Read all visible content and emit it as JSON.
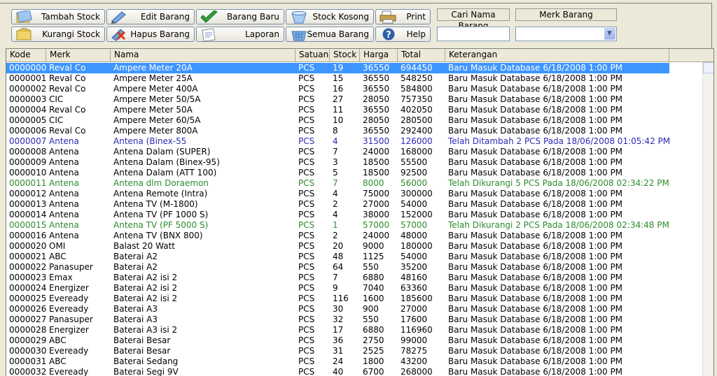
{
  "toolbar": {
    "buttons": [
      {
        "key": "tambah",
        "label": "Tambah Stock",
        "icon": "add-stock-icon"
      },
      {
        "key": "kurangi",
        "label": "Kurangi Stock",
        "icon": "reduce-stock-icon"
      },
      {
        "key": "edit",
        "label": "Edit Barang",
        "icon": "edit-item-icon"
      },
      {
        "key": "hapus",
        "label": "Hapus Barang",
        "icon": "delete-item-icon"
      },
      {
        "key": "baru",
        "label": "Barang Baru",
        "icon": "checkmark-icon"
      },
      {
        "key": "laporan",
        "label": "Laporan",
        "icon": "report-icon"
      },
      {
        "key": "kosong",
        "label": "Stock Kosong",
        "icon": "empty-stock-icon"
      },
      {
        "key": "semua",
        "label": "Semua Barang",
        "icon": "all-items-icon"
      },
      {
        "key": "print",
        "label": "Print",
        "icon": "printer-icon"
      },
      {
        "key": "help",
        "label": "Help",
        "icon": "help-icon"
      }
    ]
  },
  "search": {
    "name_label": "Cari Nama Barang",
    "name_value": "",
    "brand_label": "Merk Barang",
    "brand_value": ""
  },
  "table": {
    "columns": [
      "Kode",
      "Merk",
      "Nama",
      "Satuan",
      "Stock",
      "Harga",
      "Total",
      "Keterangan"
    ],
    "selected_index": 0,
    "rows": [
      [
        "0000000",
        "Reval Co",
        "Ampere Meter 20A",
        "PCS",
        "19",
        "36550",
        "694450",
        "Baru Masuk Database 6/18/2008 1:00 PM",
        "normal"
      ],
      [
        "0000001",
        "Reval Co",
        "Ampere Meter 25A",
        "PCS",
        "15",
        "36550",
        "548250",
        "Baru Masuk Database 6/18/2008 1:00 PM",
        "normal"
      ],
      [
        "0000002",
        "Reval Co",
        "Ampere Meter 400A",
        "PCS",
        "16",
        "36550",
        "584800",
        "Baru Masuk Database 6/18/2008 1:00 PM",
        "normal"
      ],
      [
        "0000003",
        "CIC",
        "Ampere Meter 50/5A",
        "PCS",
        "27",
        "28050",
        "757350",
        "Baru Masuk Database 6/18/2008 1:00 PM",
        "normal"
      ],
      [
        "0000004",
        "Reval Co",
        "Ampere Meter 50A",
        "PCS",
        "11",
        "36550",
        "402050",
        "Baru Masuk Database 6/18/2008 1:00 PM",
        "normal"
      ],
      [
        "0000005",
        "CIC",
        "Ampere Meter 60/5A",
        "PCS",
        "10",
        "28050",
        "280500",
        "Baru Masuk Database 6/18/2008 1:00 PM",
        "normal"
      ],
      [
        "0000006",
        "Reval Co",
        "Ampere Meter 800A",
        "PCS",
        "8",
        "36550",
        "292400",
        "Baru Masuk Database 6/18/2008 1:00 PM",
        "normal"
      ],
      [
        "0000007",
        "Antena",
        "Antena  (Binex-55",
        "PCS",
        "4",
        "31500",
        "126000",
        "Telah Ditambah 2 PCS Pada 18/06/2008 01:05:42 PM",
        "added"
      ],
      [
        "0000008",
        "Antena",
        "Antena Dalam (SUPER)",
        "PCS",
        "7",
        "24000",
        "168000",
        "Baru Masuk Database 6/18/2008 1:00 PM",
        "normal"
      ],
      [
        "0000009",
        "Antena",
        "Antena Dalam (Binex-95)",
        "PCS",
        "3",
        "18500",
        "55500",
        "Baru Masuk Database 6/18/2008 1:00 PM",
        "normal"
      ],
      [
        "0000010",
        "Antena",
        "Antena Dalam (ATT 100)",
        "PCS",
        "5",
        "18500",
        "92500",
        "Baru Masuk Database 6/18/2008 1:00 PM",
        "normal"
      ],
      [
        "0000011",
        "Antena",
        "Antena dlm Doraemon",
        "PCS",
        "7",
        "8000",
        "56000",
        "Telah Dikurangi 5 PCS Pada 18/06/2008 02:34:22 PM",
        "reduced"
      ],
      [
        "0000012",
        "Antena",
        "Antena Remote (Intra)",
        "PCS",
        "4",
        "75000",
        "300000",
        "Baru Masuk Database 6/18/2008 1:00 PM",
        "normal"
      ],
      [
        "0000013",
        "Antena",
        "Antena TV (M-1800)",
        "PCS",
        "2",
        "27000",
        "54000",
        "Baru Masuk Database 6/18/2008 1:00 PM",
        "normal"
      ],
      [
        "0000014",
        "Antena",
        "Antena TV (PF 1000 S)",
        "PCS",
        "4",
        "38000",
        "152000",
        "Baru Masuk Database 6/18/2008 1:00 PM",
        "normal"
      ],
      [
        "0000015",
        "Antena",
        "Antena TV (PF 5000 S)",
        "PCS",
        "1",
        "57000",
        "57000",
        "Telah Dikurangi 2 PCS Pada 18/06/2008 02:34:48 PM",
        "reduced"
      ],
      [
        "0000016",
        "Antena",
        "Antena TV  (BNX 800)",
        "PCS",
        "2",
        "24000",
        "48000",
        "Baru Masuk Database 6/18/2008 1:00 PM",
        "normal"
      ],
      [
        "0000020",
        "OMI",
        "Balast 20 Watt",
        "PCS",
        "20",
        "9000",
        "180000",
        "Baru Masuk Database 6/18/2008 1:00 PM",
        "normal"
      ],
      [
        "0000021",
        "ABC",
        "Baterai A2",
        "PCS",
        "48",
        "1125",
        "54000",
        "Baru Masuk Database 6/18/2008 1:00 PM",
        "normal"
      ],
      [
        "0000022",
        "Panasuper",
        "Baterai A2",
        "PCS",
        "64",
        "550",
        "35200",
        "Baru Masuk Database 6/18/2008 1:00 PM",
        "normal"
      ],
      [
        "0000023",
        "Emax",
        "Baterai A2 isi 2",
        "PCS",
        "7",
        "6880",
        "48160",
        "Baru Masuk Database 6/18/2008 1:00 PM",
        "normal"
      ],
      [
        "0000024",
        "Energizer",
        "Baterai A2 isi 2",
        "PCS",
        "9",
        "7040",
        "63360",
        "Baru Masuk Database 6/18/2008 1:00 PM",
        "normal"
      ],
      [
        "0000025",
        "Eveready",
        "Baterai A2 isi 2",
        "PCS",
        "116",
        "1600",
        "185600",
        "Baru Masuk Database 6/18/2008 1:00 PM",
        "normal"
      ],
      [
        "0000026",
        "Eveready",
        "Baterai A3",
        "PCS",
        "30",
        "900",
        "27000",
        "Baru Masuk Database 6/18/2008 1:00 PM",
        "normal"
      ],
      [
        "0000027",
        "Panasuper",
        "Baterai A3",
        "PCS",
        "32",
        "550",
        "17600",
        "Baru Masuk Database 6/18/2008 1:00 PM",
        "normal"
      ],
      [
        "0000028",
        "Energizer",
        "Baterai A3 isi 2",
        "PCS",
        "17",
        "6880",
        "116960",
        "Baru Masuk Database 6/18/2008 1:00 PM",
        "normal"
      ],
      [
        "0000029",
        "ABC",
        "Baterai Besar",
        "PCS",
        "36",
        "2750",
        "99000",
        "Baru Masuk Database 6/18/2008 1:00 PM",
        "normal"
      ],
      [
        "0000030",
        "Eveready",
        "Baterai Besar",
        "PCS",
        "31",
        "2525",
        "78275",
        "Baru Masuk Database 6/18/2008 1:00 PM",
        "normal"
      ],
      [
        "0000031",
        "ABC",
        "Baterai Sedang",
        "PCS",
        "24",
        "1800",
        "43200",
        "Baru Masuk Database 6/18/2008 1:00 PM",
        "normal"
      ],
      [
        "0000032",
        "Eveready",
        "Baterai Segi 9V",
        "PCS",
        "40",
        "6700",
        "268000",
        "Baru Masuk Database 6/18/2008 1:00 PM",
        "normal"
      ]
    ]
  },
  "colors": {
    "selection": "#3d95ff",
    "added_text": "#2a2ab5",
    "reduced_text": "#2e8b2e"
  }
}
